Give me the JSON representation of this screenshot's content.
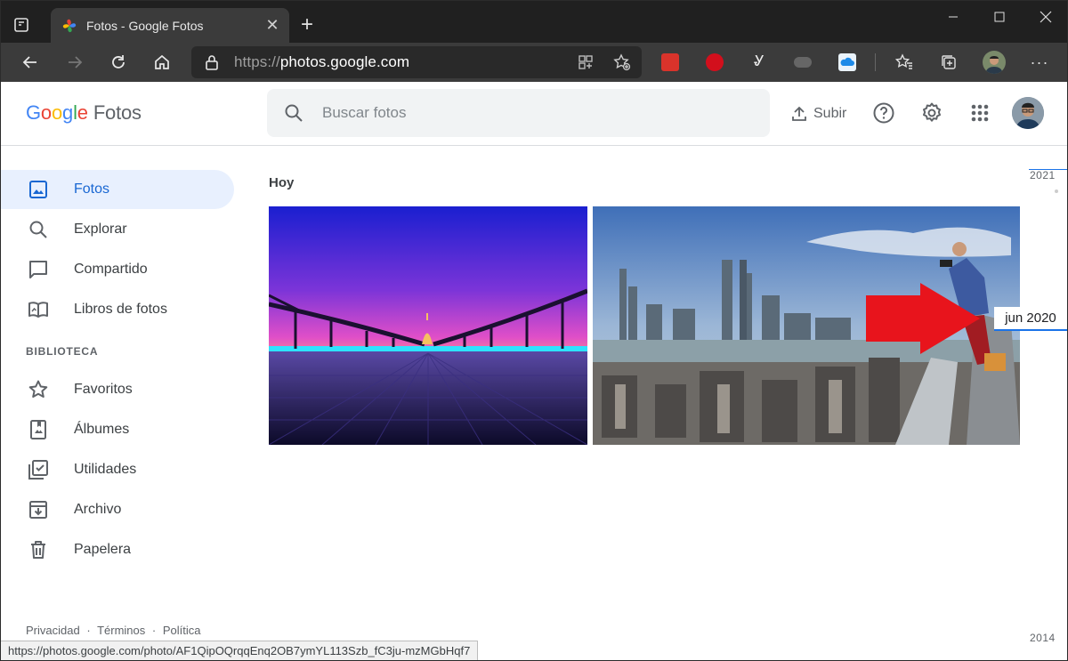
{
  "browser": {
    "tab_title": "Fotos - Google Fotos",
    "url_scheme": "https://",
    "url_host": "photos.google.com",
    "status_url": "https://photos.google.com/photo/AF1QipOQrqqEnq2OB7ymYL113Szb_fC3ju-mzMGbHqf7"
  },
  "header": {
    "logo_letters": [
      "G",
      "o",
      "o",
      "g",
      "l",
      "e"
    ],
    "product_name": "Fotos",
    "search_placeholder": "Buscar fotos",
    "upload_label": "Subir"
  },
  "sidebar": {
    "items": [
      {
        "label": "Fotos",
        "icon": "photo-icon"
      },
      {
        "label": "Explorar",
        "icon": "search-icon"
      },
      {
        "label": "Compartido",
        "icon": "chat-icon"
      },
      {
        "label": "Libros de fotos",
        "icon": "book-icon"
      }
    ],
    "section_title": "BIBLIOTECA",
    "library": [
      {
        "label": "Favoritos",
        "icon": "star-icon"
      },
      {
        "label": "Álbumes",
        "icon": "album-icon"
      },
      {
        "label": "Utilidades",
        "icon": "utilities-icon"
      },
      {
        "label": "Archivo",
        "icon": "archive-icon"
      },
      {
        "label": "Papelera",
        "icon": "trash-icon"
      }
    ],
    "footer": [
      "Privacidad",
      "Términos",
      "Política"
    ]
  },
  "main": {
    "day_label": "Hoy"
  },
  "scrubber": {
    "year_top": "2021",
    "year_bottom": "2014",
    "hover_date": "jun 2020"
  },
  "colors": {
    "accent": "#1a73e8",
    "active_bg": "#e8f0fe",
    "arrow": "#e8141c"
  }
}
